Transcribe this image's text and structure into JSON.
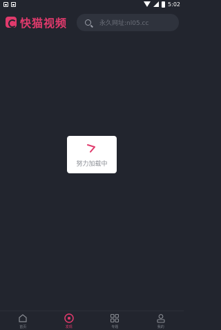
{
  "status_bar": {
    "time": "5:02"
  },
  "header": {
    "app_title": "快猫视频",
    "search_placeholder": "永久网址:nl05.cc"
  },
  "loading": {
    "text": "努力加载中"
  },
  "bottom_nav": {
    "items": [
      {
        "label": "首页",
        "icon": "home-icon",
        "active": false
      },
      {
        "label": "发现",
        "icon": "disc-icon",
        "active": true
      },
      {
        "label": "专题",
        "icon": "grid-icon",
        "active": false
      },
      {
        "label": "我的",
        "icon": "user-icon",
        "active": false
      }
    ]
  },
  "colors": {
    "background": "#22252e",
    "accent": "#e03a6c",
    "search_bg": "#2f333d"
  }
}
